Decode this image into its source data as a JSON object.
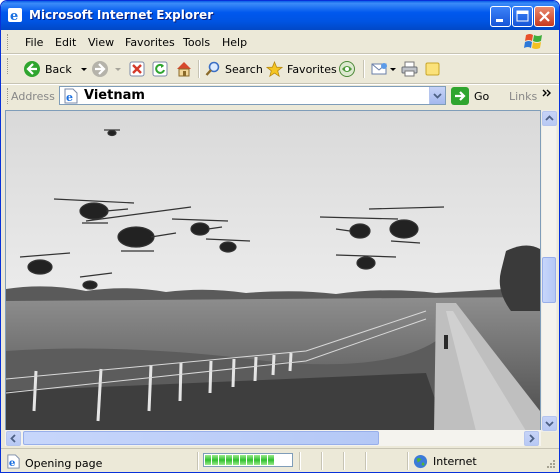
{
  "window": {
    "title": "Microsoft Internet Explorer"
  },
  "menu": {
    "items": [
      "File",
      "Edit",
      "View",
      "Favorites",
      "Tools",
      "Help"
    ]
  },
  "toolbar": {
    "back_label": "Back",
    "search_label": "Search",
    "favorites_label": "Favorites"
  },
  "address": {
    "label": "Address",
    "value": "Vietnam",
    "go_label": "Go",
    "links_label": "Links"
  },
  "status": {
    "text": "Opening page",
    "progress": 0.85,
    "zone": "Internet"
  },
  "colors": {
    "titlebar": "#0054E3",
    "chrome": "#ECE9D8",
    "scrollbar": "#C6D3F7",
    "progress": "#2FBF2F"
  }
}
